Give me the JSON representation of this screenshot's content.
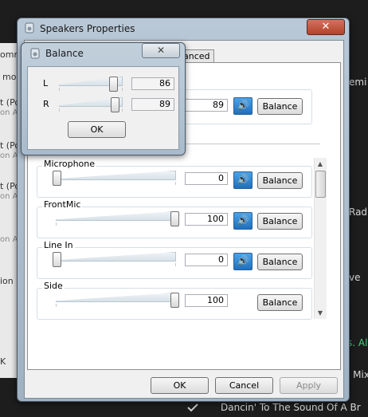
{
  "background": {
    "right_items": [
      {
        "text": "emi"
      },
      {
        "text": "Rad"
      },
      {
        "text": "ve"
      },
      {
        "text": "s. Al"
      },
      {
        "text": "l Mix"
      },
      {
        "text": "Dancin' To The Sound Of A Br"
      }
    ],
    "left_items": [
      {
        "text": "ommu"
      },
      {
        "text": "mo"
      },
      {
        "text": "t (Po"
      },
      {
        "text": "on A"
      },
      {
        "text": "t (Po"
      },
      {
        "text": "on A"
      },
      {
        "text": "t (Po"
      },
      {
        "text": "on A"
      },
      {
        "text": "on A"
      },
      {
        "text": "ion"
      },
      {
        "text": "K"
      }
    ]
  },
  "speakers_window": {
    "title": "Speakers Properties",
    "close_label": "✕",
    "tabs": [
      {
        "label": "anced"
      }
    ],
    "main_value": "89",
    "main_balance_label": "Balance",
    "channels": [
      {
        "name": "Microphone",
        "value": "0",
        "level": 0,
        "balance_label": "Balance"
      },
      {
        "name": "FrontMic",
        "value": "100",
        "level": 100,
        "balance_label": "Balance"
      },
      {
        "name": "Line In",
        "value": "0",
        "level": 0,
        "balance_label": "Balance"
      },
      {
        "name": "Side",
        "value": "100",
        "level": 100,
        "balance_label": "Balance"
      }
    ],
    "ok_label": "OK",
    "cancel_label": "Cancel",
    "apply_label": "Apply"
  },
  "balance_dialog": {
    "title": "Balance",
    "close_label": "✕",
    "left_label": "L",
    "left_value": "86",
    "left_level": 86,
    "right_label": "R",
    "right_value": "89",
    "right_level": 89,
    "ok_label": "OK"
  }
}
